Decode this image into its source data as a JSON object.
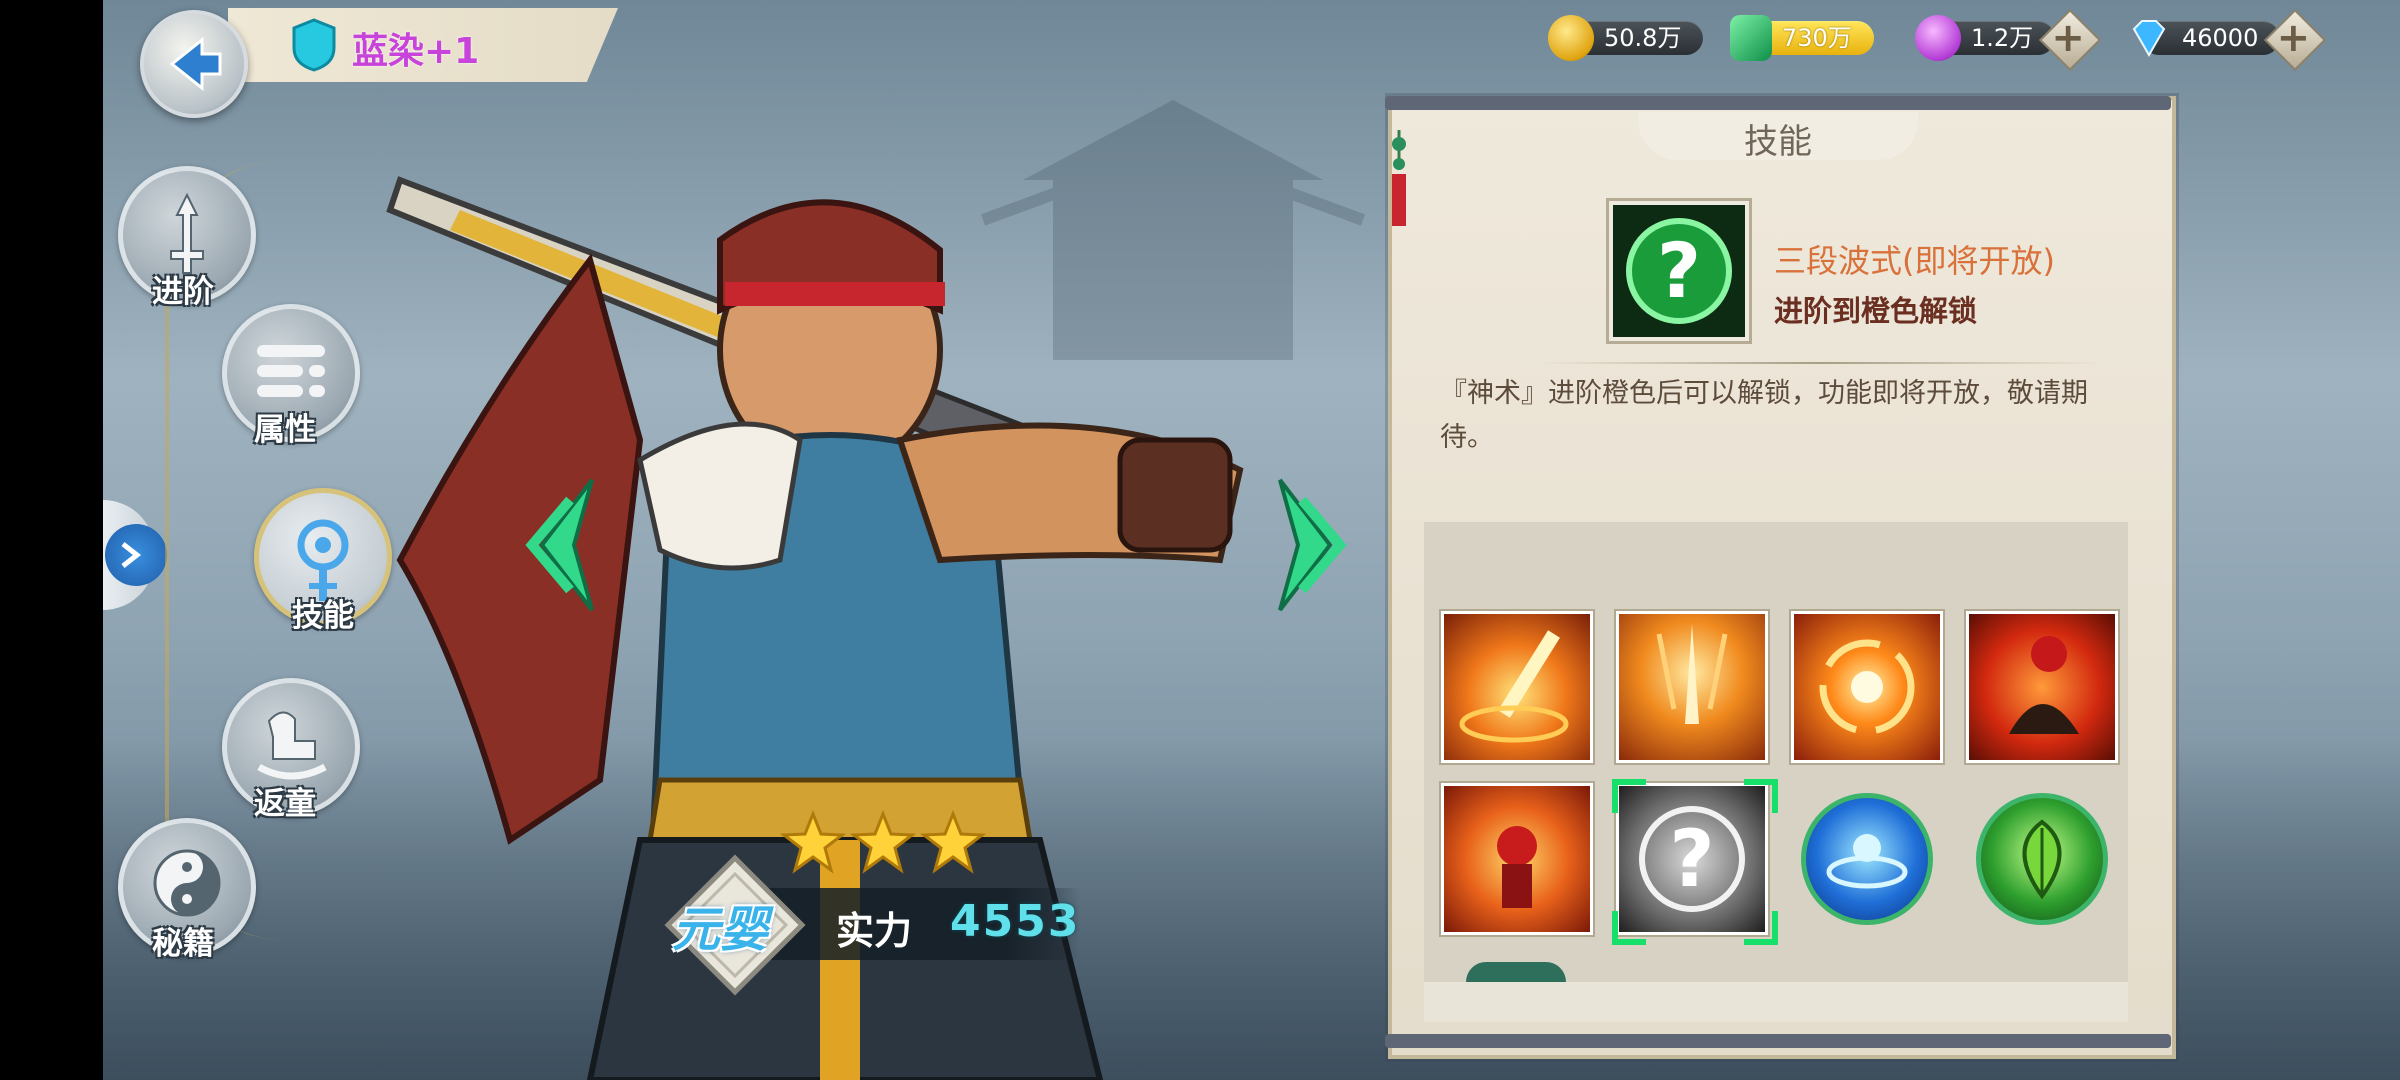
{
  "header": {
    "hero_name": "蓝染+1"
  },
  "currencies": [
    {
      "icon": "gold-coin-icon",
      "value": "50.8万"
    },
    {
      "icon": "jade-icon",
      "value": "730万"
    },
    {
      "icon": "candy-icon",
      "value": "1.2万"
    },
    {
      "icon": "diamond-icon",
      "value": "46000"
    }
  ],
  "menu": {
    "items": [
      {
        "id": "advance",
        "label": "进阶",
        "icon": "sword-up-icon"
      },
      {
        "id": "attributes",
        "label": "属性",
        "icon": "attribute-list-icon"
      },
      {
        "id": "skills",
        "label": "技能",
        "icon": "skill-orb-icon",
        "active": true
      },
      {
        "id": "rejuvenate",
        "label": "返童",
        "icon": "rocking-horse-icon"
      },
      {
        "id": "secrets",
        "label": "秘籍",
        "icon": "yin-yang-icon"
      }
    ]
  },
  "hero": {
    "stars": 3,
    "realm": "元婴",
    "power_label": "实力",
    "power_value": "4553"
  },
  "panel": {
    "title": "技能",
    "selected_skill": {
      "name": "三段波式(即将开放)",
      "unlock": "进阶到橙色解锁",
      "description": "『神术』进阶橙色后可以解锁，功能即将开放，敬请期待。"
    },
    "skills": [
      {
        "icon": "fire-slash-icon"
      },
      {
        "icon": "fire-sword-rain-icon"
      },
      {
        "icon": "fire-vortex-icon"
      },
      {
        "icon": "fire-summon-icon"
      },
      {
        "icon": "fire-warrior-icon"
      },
      {
        "icon": "locked-question-icon",
        "selected": true
      },
      {
        "icon": "water-rune-icon"
      },
      {
        "icon": "leaf-heal-icon"
      }
    ]
  },
  "colors": {
    "name_purple": "#c743d9",
    "power_cyan": "#5fe0ea",
    "skill_name_orange": "#d9713a",
    "selection_green": "#16e06a"
  }
}
